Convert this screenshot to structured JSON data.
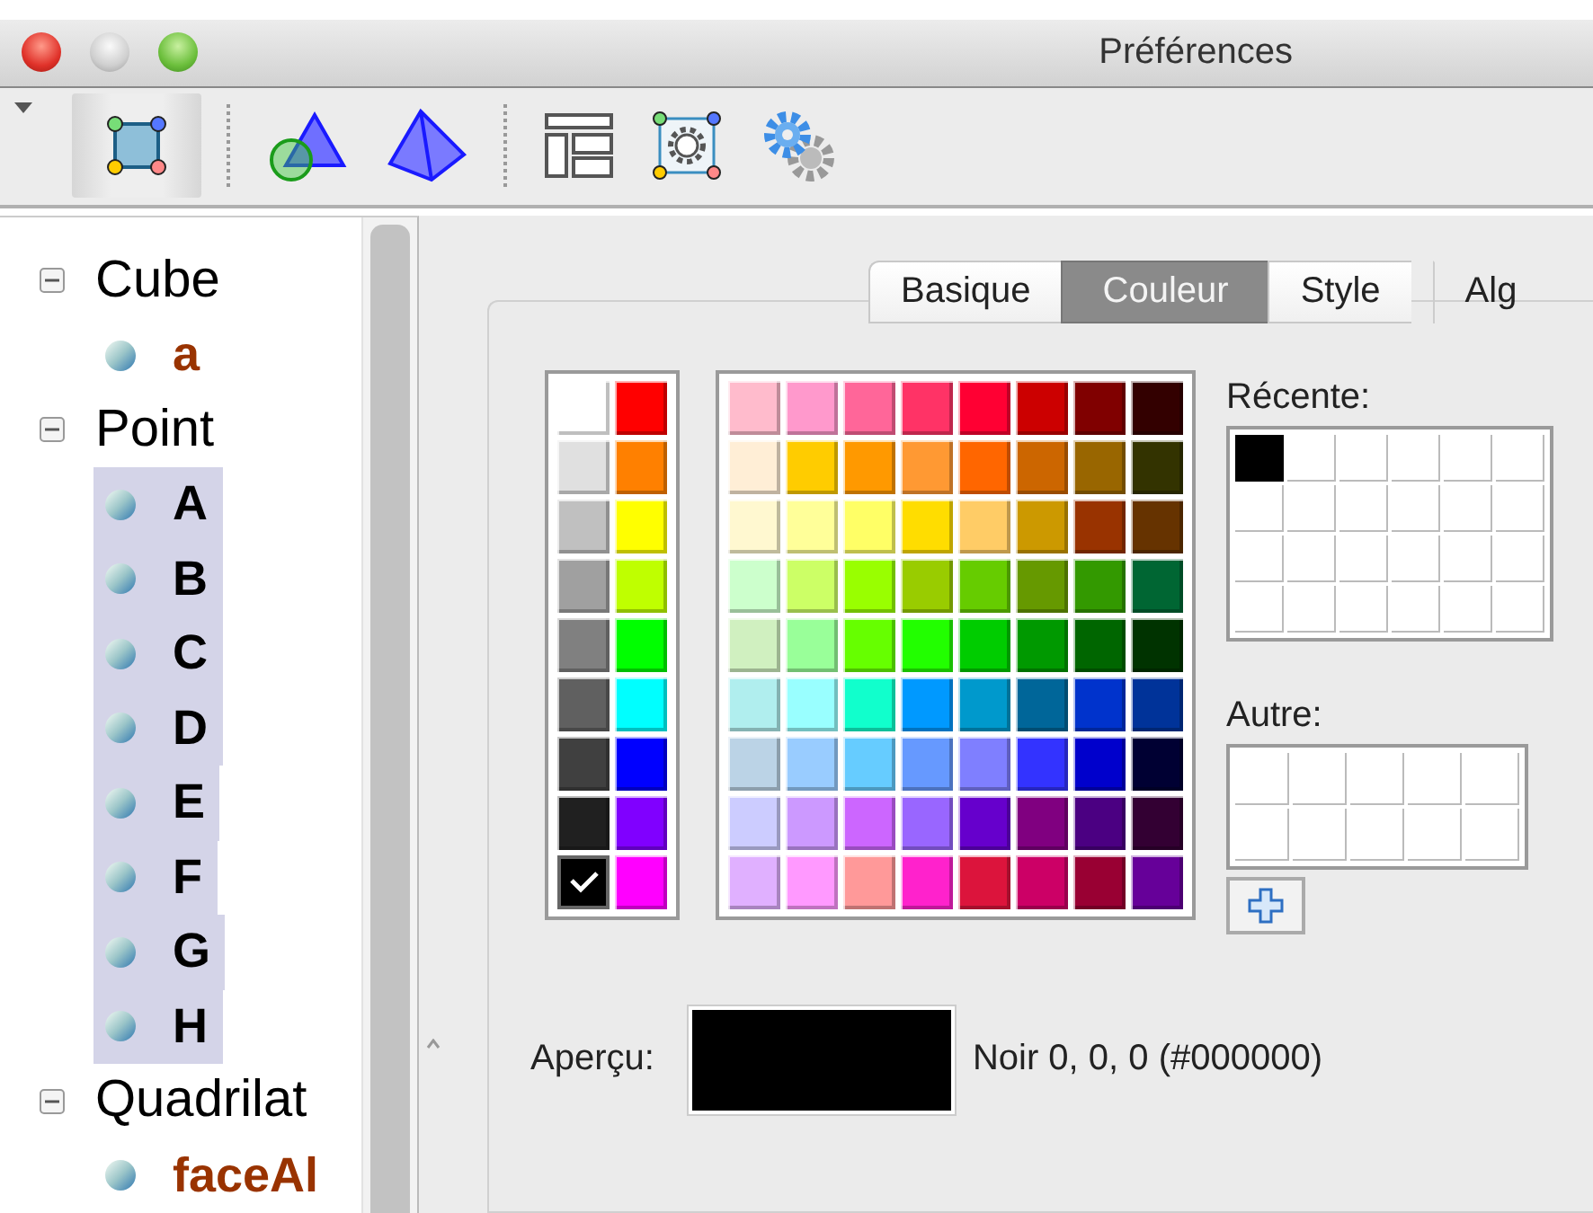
{
  "window": {
    "title": "Préférences"
  },
  "toolbar": {
    "groups": [
      {
        "items": [
          {
            "kind": "square",
            "selected": true
          }
        ]
      },
      {
        "items": [
          {
            "kind": "circle-triangle",
            "selected": false
          },
          {
            "kind": "pyramid",
            "selected": false
          }
        ]
      },
      {
        "items": [
          {
            "kind": "layout",
            "selected": false
          },
          {
            "kind": "gear-square",
            "selected": false
          },
          {
            "kind": "gears",
            "selected": false
          }
        ]
      }
    ]
  },
  "tree": [
    {
      "label": "Cube",
      "expanded": true,
      "children": [
        {
          "label": "a",
          "color": "#993300",
          "selected": false
        }
      ]
    },
    {
      "label": "Point",
      "expanded": true,
      "children": [
        {
          "label": "A",
          "color": "#000000",
          "selected": true
        },
        {
          "label": "B",
          "color": "#000000",
          "selected": true
        },
        {
          "label": "C",
          "color": "#000000",
          "selected": true
        },
        {
          "label": "D",
          "color": "#000000",
          "selected": true
        },
        {
          "label": "E",
          "color": "#000000",
          "selected": true
        },
        {
          "label": "F",
          "color": "#000000",
          "selected": true
        },
        {
          "label": "G",
          "color": "#000000",
          "selected": true
        },
        {
          "label": "H",
          "color": "#000000",
          "selected": true
        }
      ]
    },
    {
      "label": "Quadrilat",
      "expanded": true,
      "children": [
        {
          "label": "faceAl",
          "color": "#993300",
          "selected": false
        }
      ]
    }
  ],
  "tabs": [
    {
      "label": "Basique",
      "selected": false
    },
    {
      "label": "Couleur",
      "selected": true
    },
    {
      "label": "Style",
      "selected": false
    },
    {
      "label": "Alg",
      "selected": false
    }
  ],
  "palette": {
    "standard": [
      {
        "color": "#ffffff",
        "selected": false
      },
      {
        "color": "#ff0000",
        "selected": false
      },
      {
        "color": "#e0e0e0",
        "selected": false
      },
      {
        "color": "#ff8000",
        "selected": false
      },
      {
        "color": "#c0c0c0",
        "selected": false
      },
      {
        "color": "#ffff00",
        "selected": false
      },
      {
        "color": "#a0a0a0",
        "selected": false
      },
      {
        "color": "#bfff00",
        "selected": false
      },
      {
        "color": "#808080",
        "selected": false
      },
      {
        "color": "#00ff00",
        "selected": false
      },
      {
        "color": "#606060",
        "selected": false
      },
      {
        "color": "#00ffff",
        "selected": false
      },
      {
        "color": "#404040",
        "selected": false
      },
      {
        "color": "#0000ff",
        "selected": false
      },
      {
        "color": "#202020",
        "selected": false
      },
      {
        "color": "#8000ff",
        "selected": false
      },
      {
        "color": "#000000",
        "selected": true
      },
      {
        "color": "#ff00ff",
        "selected": false
      }
    ],
    "swatches": [
      {
        "color": "#ffbbcc",
        "selected": false
      },
      {
        "color": "#ff99cc",
        "selected": false
      },
      {
        "color": "#ff6699",
        "selected": false
      },
      {
        "color": "#ff3366",
        "selected": false
      },
      {
        "color": "#ff0033",
        "selected": false
      },
      {
        "color": "#cc0000",
        "selected": false
      },
      {
        "color": "#800000",
        "selected": false
      },
      {
        "color": "#330000",
        "selected": false
      },
      {
        "color": "#ffeed6",
        "selected": false
      },
      {
        "color": "#ffcc00",
        "selected": false
      },
      {
        "color": "#ff9900",
        "selected": false
      },
      {
        "color": "#ff9933",
        "selected": false
      },
      {
        "color": "#ff6600",
        "selected": false
      },
      {
        "color": "#cc6600",
        "selected": false
      },
      {
        "color": "#996600",
        "selected": false
      },
      {
        "color": "#333300",
        "selected": false
      },
      {
        "color": "#fff8d0",
        "selected": false
      },
      {
        "color": "#ffff99",
        "selected": false
      },
      {
        "color": "#ffff66",
        "selected": false
      },
      {
        "color": "#ffdd00",
        "selected": false
      },
      {
        "color": "#ffcc66",
        "selected": false
      },
      {
        "color": "#cc9900",
        "selected": false
      },
      {
        "color": "#993300",
        "selected": false
      },
      {
        "color": "#663300",
        "selected": false
      },
      {
        "color": "#ccffcc",
        "selected": false
      },
      {
        "color": "#ccff66",
        "selected": false
      },
      {
        "color": "#99ff00",
        "selected": false
      },
      {
        "color": "#99cc00",
        "selected": false
      },
      {
        "color": "#66cc00",
        "selected": false
      },
      {
        "color": "#669900",
        "selected": false
      },
      {
        "color": "#339900",
        "selected": false
      },
      {
        "color": "#006633",
        "selected": false
      },
      {
        "color": "#d0f0c0",
        "selected": false
      },
      {
        "color": "#99ff99",
        "selected": false
      },
      {
        "color": "#66ff00",
        "selected": false
      },
      {
        "color": "#22ff00",
        "selected": false
      },
      {
        "color": "#00cc00",
        "selected": false
      },
      {
        "color": "#009900",
        "selected": false
      },
      {
        "color": "#006600",
        "selected": false
      },
      {
        "color": "#003300",
        "selected": false
      },
      {
        "color": "#b0eeee",
        "selected": false
      },
      {
        "color": "#99ffff",
        "selected": false
      },
      {
        "color": "#11ffcc",
        "selected": false
      },
      {
        "color": "#0099ff",
        "selected": false
      },
      {
        "color": "#0099cc",
        "selected": false
      },
      {
        "color": "#006699",
        "selected": false
      },
      {
        "color": "#0033cc",
        "selected": false
      },
      {
        "color": "#003399",
        "selected": false
      },
      {
        "color": "#bbd3e6",
        "selected": false
      },
      {
        "color": "#99ccff",
        "selected": false
      },
      {
        "color": "#66ccff",
        "selected": false
      },
      {
        "color": "#6699ff",
        "selected": false
      },
      {
        "color": "#7f7fff",
        "selected": false
      },
      {
        "color": "#3333ff",
        "selected": false
      },
      {
        "color": "#0000cc",
        "selected": false
      },
      {
        "color": "#000033",
        "selected": false
      },
      {
        "color": "#ccccff",
        "selected": false
      },
      {
        "color": "#cc99ff",
        "selected": false
      },
      {
        "color": "#cc66ff",
        "selected": false
      },
      {
        "color": "#9966ff",
        "selected": false
      },
      {
        "color": "#6600cc",
        "selected": false
      },
      {
        "color": "#800080",
        "selected": false
      },
      {
        "color": "#4b0082",
        "selected": false
      },
      {
        "color": "#330033",
        "selected": false
      },
      {
        "color": "#e0b0ff",
        "selected": false
      },
      {
        "color": "#ff99ff",
        "selected": false
      },
      {
        "color": "#ff9999",
        "selected": false
      },
      {
        "color": "#ff22cc",
        "selected": false
      },
      {
        "color": "#dc143c",
        "selected": false
      },
      {
        "color": "#cc0066",
        "selected": false
      },
      {
        "color": "#990033",
        "selected": false
      },
      {
        "color": "#660099",
        "selected": false
      }
    ],
    "recent": {
      "label": "Récente:",
      "colors": [
        {
          "color": "#000000"
        }
      ]
    },
    "other": {
      "label": "Autre:"
    }
  },
  "preview": {
    "label": "Aperçu:",
    "color": "#000000",
    "description": "Noir 0, 0, 0 (#000000)"
  }
}
